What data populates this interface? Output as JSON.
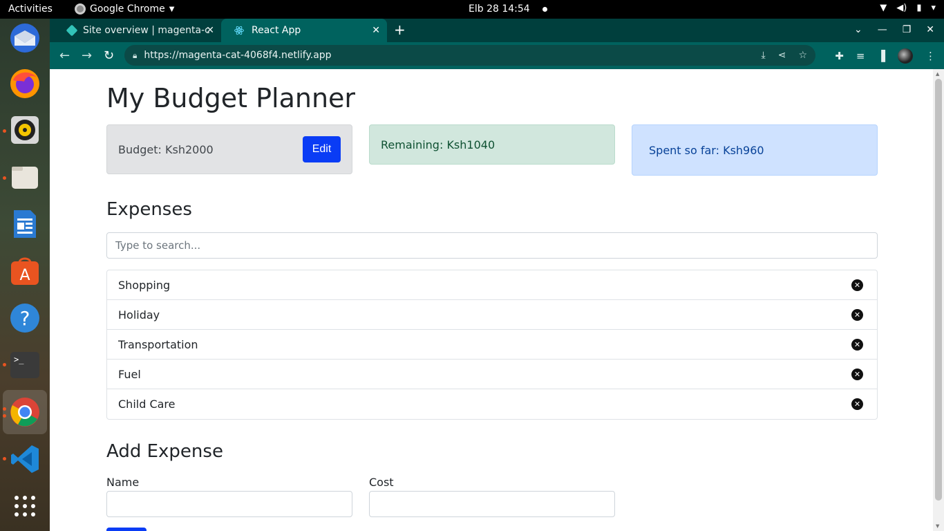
{
  "system": {
    "activities_label": "Activities",
    "app_name": "Google Chrome",
    "clock": "Elb 28  14:54"
  },
  "dock": {
    "items": [
      "thunderbird-icon",
      "firefox-icon",
      "rhythmbox-icon",
      "files-icon",
      "libreoffice-writer-icon",
      "app-center-icon",
      "help-icon",
      "terminal-icon",
      "chrome-icon",
      "vscode-icon",
      "show-apps-icon"
    ]
  },
  "browser": {
    "tabs": [
      {
        "title": "Site overview | magenta-c",
        "active": false
      },
      {
        "title": "React App",
        "active": true
      }
    ],
    "url": "https://magenta-cat-4068f4.netlify.app"
  },
  "page": {
    "title": "My Budget Planner",
    "budget_text": "Budget: Ksh2000",
    "edit_label": "Edit",
    "remaining_text": "Remaining: Ksh1040",
    "spent_text": "Spent so far: Ksh960",
    "expenses_heading": "Expenses",
    "search_placeholder": "Type to search...",
    "expenses": [
      {
        "name": "Shopping"
      },
      {
        "name": "Holiday"
      },
      {
        "name": "Transportation"
      },
      {
        "name": "Fuel"
      },
      {
        "name": "Child Care"
      }
    ],
    "add_heading": "Add Expense",
    "name_label": "Name",
    "cost_label": "Cost"
  },
  "colors": {
    "tabstrip": "#003f3d",
    "toolbar": "#00625e",
    "primary_button": "#0a3cf5",
    "budget_bg": "#e2e3e5",
    "remaining_bg": "#d1e7dd",
    "spent_bg": "#cfe2ff"
  }
}
